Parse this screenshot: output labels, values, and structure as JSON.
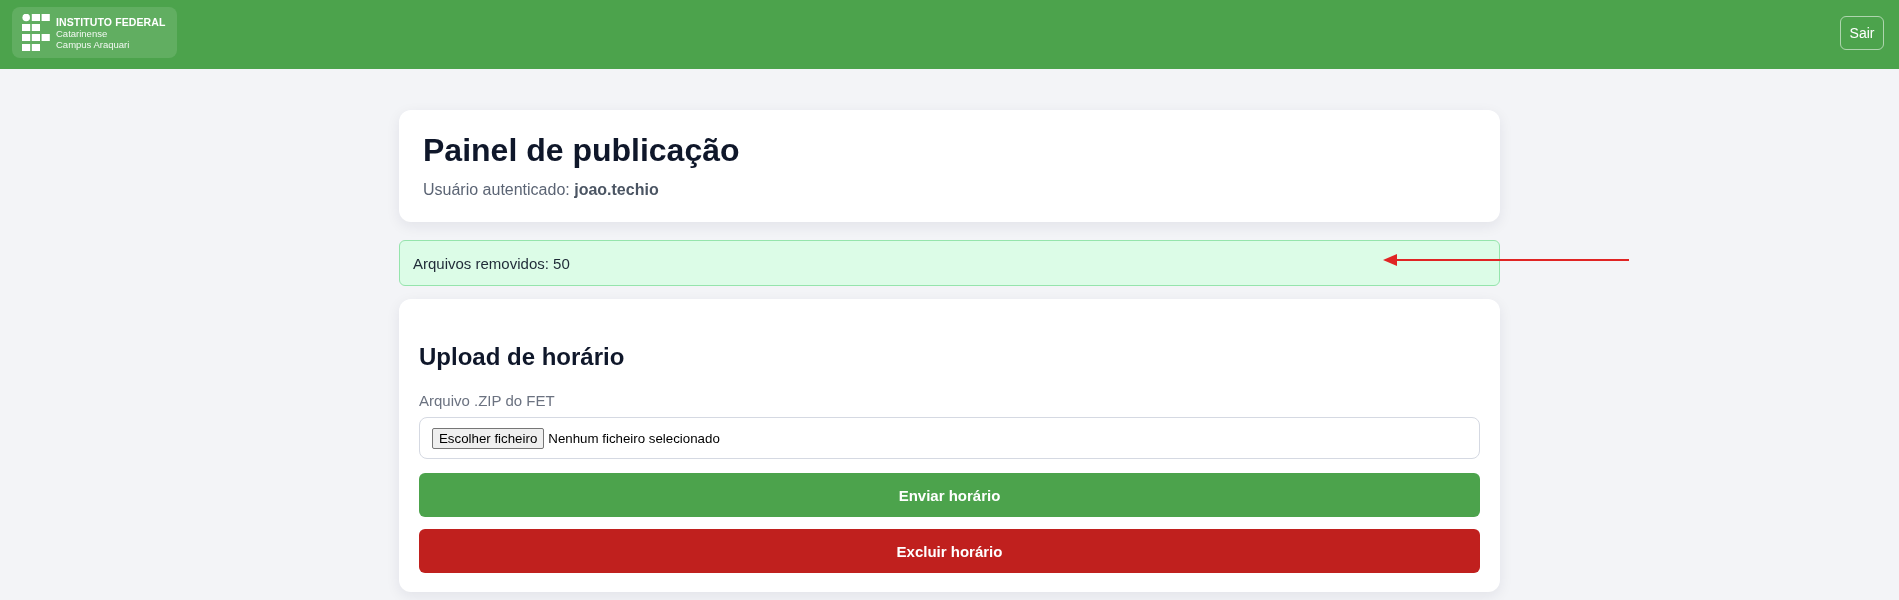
{
  "header": {
    "logo": {
      "title": "INSTITUTO FEDERAL",
      "lines": [
        "Catarinense",
        "Campus Araquari"
      ]
    },
    "logout_button": "Sair"
  },
  "intro_card": {
    "title": "Painel de publicação",
    "subtitle": "Usuário autenticado: **joao.techio**"
  },
  "alert": {
    "kind": "success",
    "text": "Arquivos removidos: 50"
  },
  "upload_card": {
    "title": "Upload de horário",
    "field_label": "Arquivo .ZIP do FET",
    "file_input": {
      "button": "Escolher ficheiro",
      "status": "Nenhum ficheiro selecionado"
    },
    "buttons": [
      {
        "label": "Enviar horário",
        "kind": "primary"
      },
      {
        "label": "Excluir horário",
        "kind": "danger"
      }
    ]
  }
}
